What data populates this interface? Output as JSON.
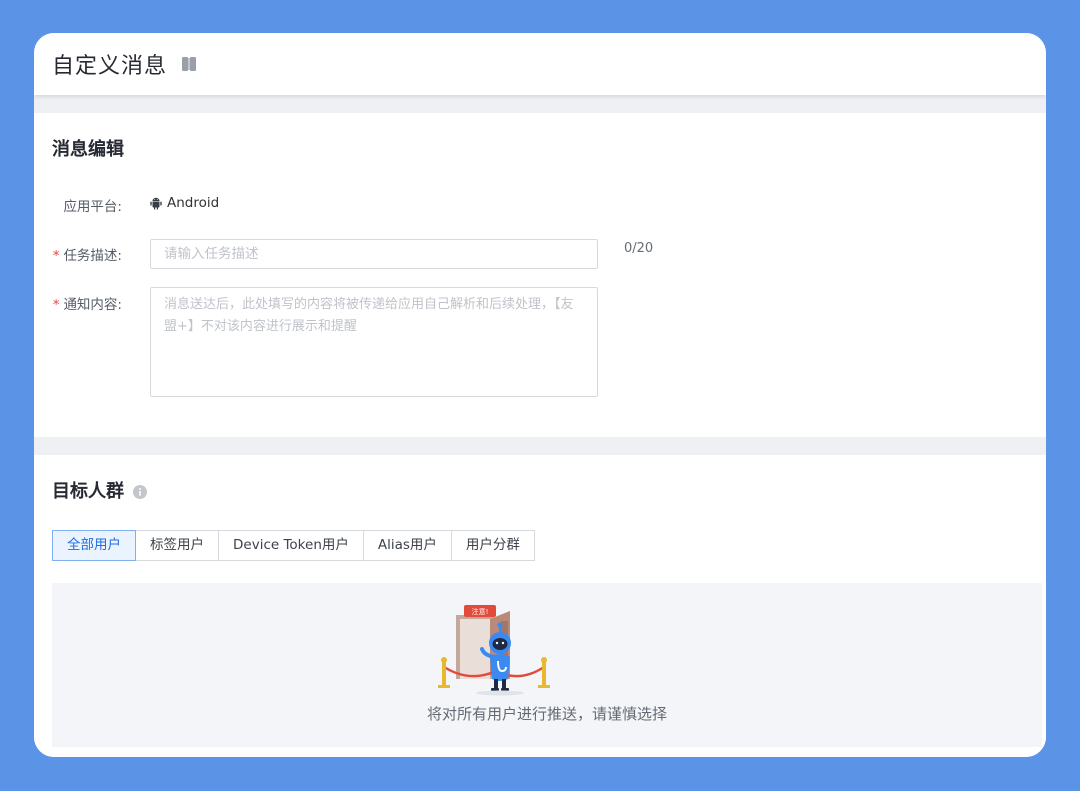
{
  "page": {
    "title": "自定义消息"
  },
  "edit": {
    "title": "消息编辑",
    "platform_label": "应用平台:",
    "platform_value": "Android",
    "desc_label": "任务描述:",
    "desc_placeholder": "请输入任务描述",
    "desc_counter": "0/20",
    "content_label": "通知内容:",
    "content_placeholder": "消息送达后，此处填写的内容将被传递给应用自己解析和后续处理，【友盟+】不对该内容进行展示和提醒",
    "required_mark": "*"
  },
  "audience": {
    "title": "目标人群",
    "tabs": [
      "全部用户",
      "标签用户",
      "Device Token用户",
      "Alias用户",
      "用户分群"
    ],
    "active_tab": "全部用户",
    "sign_text": "注意!",
    "empty_text": "将对所有用户进行推送，请谨慎选择"
  },
  "colors": {
    "background": "#5b93e6",
    "accent": "#1f6fe0",
    "required": "#f5403b"
  },
  "icons": {
    "doc": "document-icon",
    "android": "android-icon",
    "info": "info-icon"
  }
}
